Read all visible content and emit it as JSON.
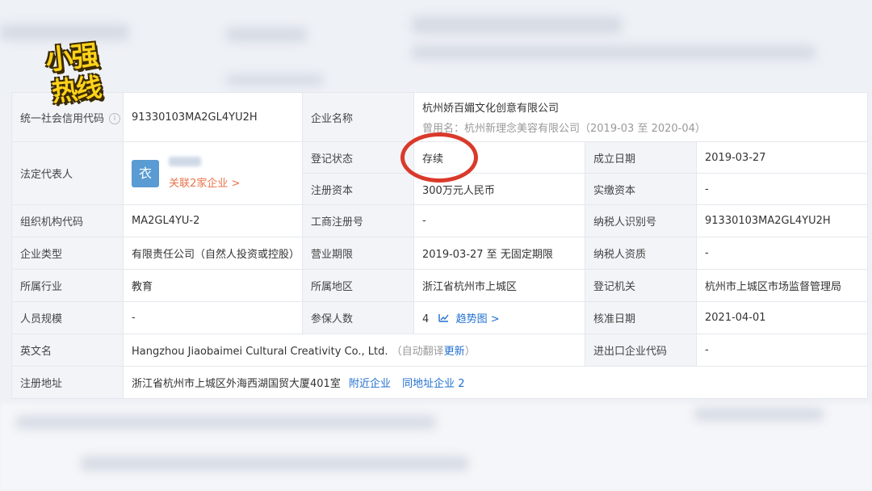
{
  "logo": {
    "line1": "小强",
    "line2": "热线"
  },
  "table": {
    "credit_code_label": "统一社会信用代码",
    "credit_code_info_icon": "i",
    "credit_code": "91330103MA2GL4YU2H",
    "company_name_label": "企业名称",
    "company_name": "杭州娇百媚文化创意有限公司",
    "former_name": "曾用名：杭州新理念美容有限公司（2019-03 至 2020-04）",
    "legal_rep_label": "法定代表人",
    "legal_rep_avatar": "衣",
    "legal_rep_related": "关联2家企业 >",
    "reg_status_label": "登记状态",
    "reg_status": "存续",
    "est_date_label": "成立日期",
    "est_date": "2019-03-27",
    "reg_capital_label": "注册资本",
    "reg_capital": "300万元人民币",
    "paid_capital_label": "实缴资本",
    "paid_capital": "-",
    "org_code_label": "组织机构代码",
    "org_code": "MA2GL4YU-2",
    "biz_reg_no_label": "工商注册号",
    "biz_reg_no": "-",
    "taxpayer_id_label": "纳税人识别号",
    "taxpayer_id": "91330103MA2GL4YU2H",
    "company_type_label": "企业类型",
    "company_type": "有限责任公司（自然人投资或控股）",
    "biz_term_label": "营业期限",
    "biz_term": "2019-03-27 至 无固定期限",
    "taxpayer_qual_label": "纳税人资质",
    "taxpayer_qual": "-",
    "industry_label": "所属行业",
    "industry": "教育",
    "region_label": "所属地区",
    "region": "浙江省杭州市上城区",
    "reg_authority_label": "登记机关",
    "reg_authority": "杭州市上城区市场监督管理局",
    "staff_size_label": "人员规模",
    "staff_size": "-",
    "insured_label": "参保人数",
    "insured": "4",
    "insured_trend": "趋势图 >",
    "approval_date_label": "核准日期",
    "approval_date": "2021-04-01",
    "english_name_label": "英文名",
    "english_name": "Hangzhou Jiaobaimei Cultural Creativity Co., Ltd.",
    "auto_translate_open": "（自动翻译",
    "update_link": "更新",
    "auto_translate_close": "）",
    "import_export_label": "进出口企业代码",
    "import_export": "-",
    "address_label": "注册地址",
    "address": "浙江省杭州市上城区外海西湖国贸大厦401室",
    "nearby_link": "附近企业",
    "same_address_link": "同地址企业 2"
  },
  "colors": {
    "link": "#1f6fcf",
    "accent_orange": "#e8734a",
    "annotation_red": "#d93a2b"
  }
}
